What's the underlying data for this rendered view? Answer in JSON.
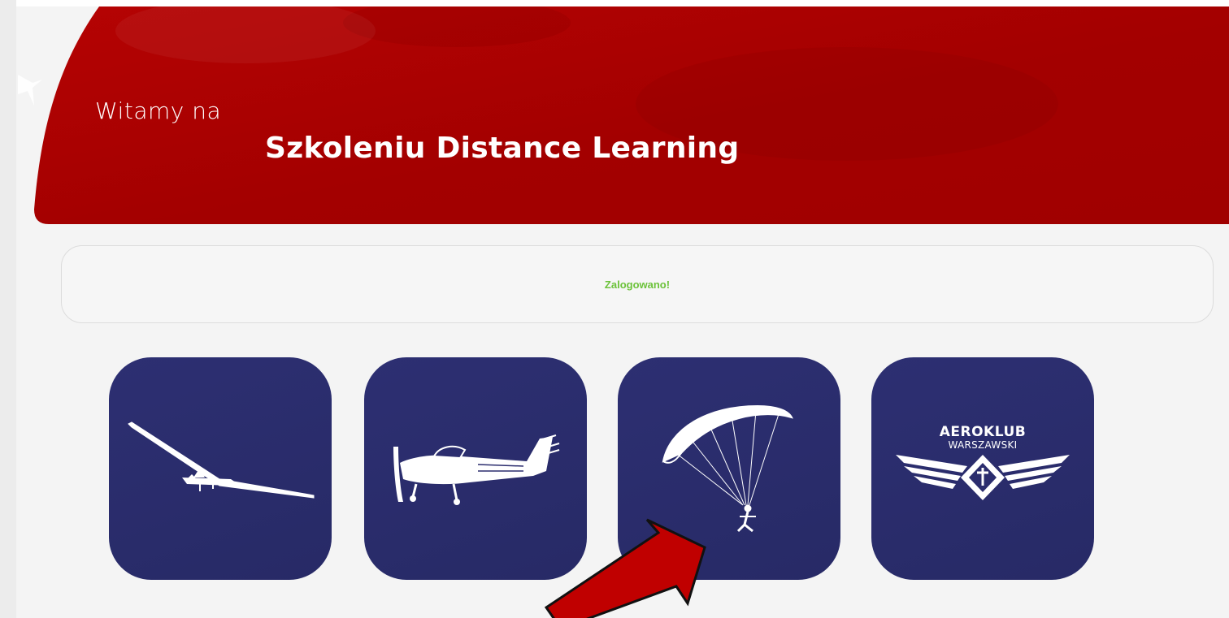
{
  "hero": {
    "line1": "Witamy na",
    "line2": "Szkoleniu Distance Learning"
  },
  "status": {
    "message": "Zalogowano!"
  },
  "tiles": [
    {
      "icon": "glider-icon"
    },
    {
      "icon": "airplane-icon"
    },
    {
      "icon": "parachute-icon"
    },
    {
      "icon": "aeroklub-logo",
      "logo_line1": "AEROKLUB",
      "logo_line2": "WARSZAWSKI"
    }
  ],
  "colors": {
    "hero_red": "#a80000",
    "tile_navy": "#2b2d6e",
    "status_green": "#6cc23a",
    "arrow_red": "#c00000"
  }
}
